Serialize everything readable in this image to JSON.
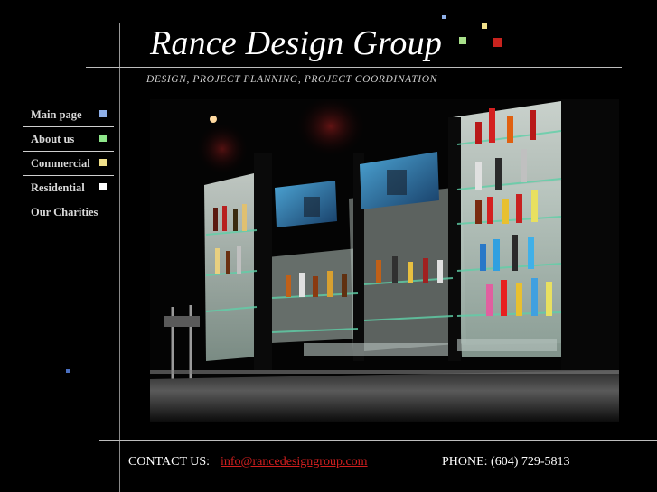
{
  "header": {
    "title": "Rance Design Group",
    "subtitle": "DESIGN, PROJECT PLANNING, PROJECT COORDINATION"
  },
  "nav": {
    "items": [
      {
        "label": "Main page",
        "color": "#8fb0e8"
      },
      {
        "label": "About us",
        "color": "#8ee68a"
      },
      {
        "label": "Commercial",
        "color": "#f0e08a"
      },
      {
        "label": "Residential",
        "color": "#ffffff"
      },
      {
        "label": "Our Charities"
      }
    ]
  },
  "colors": {
    "accent_red": "#c8231e",
    "accent_green": "#a8e08a",
    "accent_yellow": "#f0e08a",
    "accent_blue": "#8fb0e8",
    "email_link": "#d21f1f"
  },
  "hero": {
    "subject": "backlit-bar-shelves-with-bottles-and-tvs"
  },
  "footer": {
    "contact_label": "CONTACT US:",
    "email": "info@rancedesigngroup.com",
    "phone": "PHONE: (604) 729-5813"
  }
}
